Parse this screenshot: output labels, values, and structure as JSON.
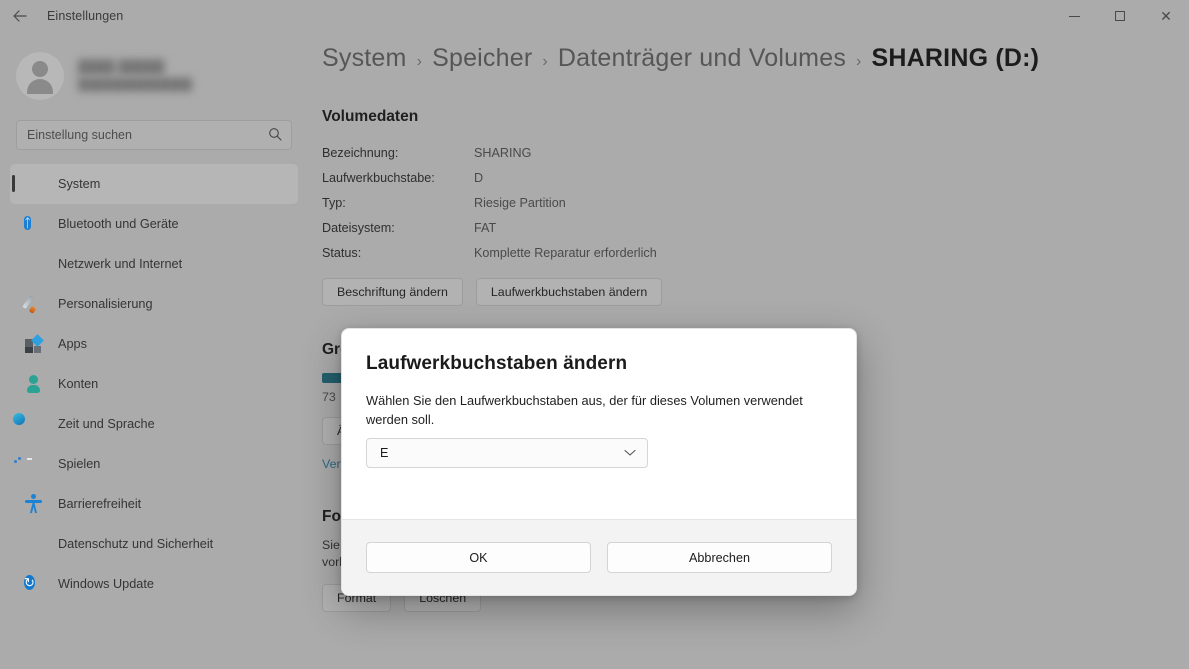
{
  "titlebar": {
    "back_label": "back-arrow",
    "app_title": "Einstellungen",
    "minimize": "—",
    "maximize": "□",
    "close": "✕"
  },
  "sidebar": {
    "profile": {
      "name": "████ █████",
      "email": "██████████████"
    },
    "search": {
      "placeholder": "Einstellung suchen",
      "value": "",
      "icon": "search-icon"
    },
    "items": [
      {
        "label": "System",
        "icon": "monitor-icon",
        "selected": true
      },
      {
        "label": "Bluetooth und Geräte",
        "icon": "bluetooth-icon",
        "selected": false
      },
      {
        "label": "Netzwerk und Internet",
        "icon": "wifi-icon",
        "selected": false
      },
      {
        "label": "Personalisierung",
        "icon": "paintbrush-icon",
        "selected": false
      },
      {
        "label": "Apps",
        "icon": "apps-icon",
        "selected": false
      },
      {
        "label": "Konten",
        "icon": "account-icon",
        "selected": false
      },
      {
        "label": "Zeit und Sprache",
        "icon": "clock-icon",
        "selected": false
      },
      {
        "label": "Spielen",
        "icon": "gamepad-icon",
        "selected": false
      },
      {
        "label": "Barrierefreiheit",
        "icon": "accessibility-icon",
        "selected": false
      },
      {
        "label": "Datenschutz und Sicherheit",
        "icon": "shield-icon",
        "selected": false
      },
      {
        "label": "Windows Update",
        "icon": "update-icon",
        "selected": false
      }
    ]
  },
  "breadcrumb": {
    "items": [
      "System",
      "Speicher",
      "Datenträger und Volumes",
      "SHARING (D:)"
    ],
    "separator": "›"
  },
  "main": {
    "volume_section": {
      "title": "Volumedaten",
      "rows": [
        {
          "key": "Bezeichnung:",
          "value": "SHARING"
        },
        {
          "key": "Laufwerkbuchstabe:",
          "value": "D"
        },
        {
          "key": "Typ:",
          "value": "Riesige Partition"
        },
        {
          "key": "Dateisystem:",
          "value": "FAT"
        },
        {
          "key": "Status:",
          "value": "Komplette Reparatur erforderlich"
        }
      ],
      "buttons": [
        "Beschriftung ändern",
        "Laufwerkbuchstaben ändern"
      ]
    },
    "size_section": {
      "title": "Größe",
      "bar_percent": 38,
      "caption": "73",
      "button": "Ändern",
      "link": "Verwalten"
    },
    "format_section": {
      "title": "Formatieren",
      "text_line1": "Sie",
      "text_line2": "vorhandenen Daten zu entfernen.",
      "buttons": [
        "Format",
        "Löschen"
      ]
    }
  },
  "dialog": {
    "title": "Laufwerkbuchstaben ändern",
    "text": "Wählen Sie den Laufwerkbuchstaben aus, der für dieses Volumen verwendet werden soll.",
    "select": {
      "value": "E",
      "chevron": "chevron-down-icon"
    },
    "ok_label": "OK",
    "cancel_label": "Abbrechen"
  },
  "colors": {
    "accent_teal": "#24606e",
    "link": "#2d6b86",
    "window_bg": "#ababab"
  }
}
